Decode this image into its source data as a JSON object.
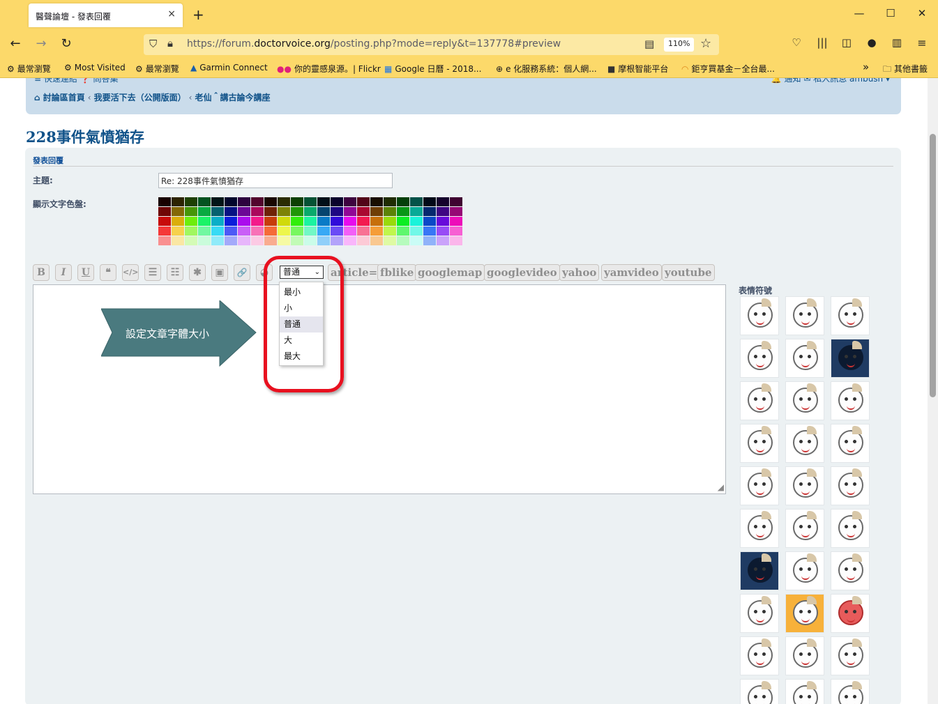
{
  "browser": {
    "tab_title": "醫聲論壇 - 發表回覆",
    "tab_close": "×",
    "new_tab": "+",
    "url_prefix": "https://forum.",
    "url_host": "doctorvoice.org",
    "url_path": "/posting.php?mode=reply&t=137778#preview",
    "zoom": "110%",
    "bookmarks": [
      {
        "label": "最常瀏覽",
        "icon": "⚙"
      },
      {
        "label": "Most Visited",
        "icon": "⚙"
      },
      {
        "label": "最常瀏覽",
        "icon": "⚙"
      },
      {
        "label": "Garmin Connect",
        "icon": "▲"
      },
      {
        "label": "你的靈感泉源。| Flickr",
        "icon": "●●"
      },
      {
        "label": "Google 日曆 - 2018...",
        "icon": "▦"
      },
      {
        "label": "e 化服務系統：個人網...",
        "icon": "⊕"
      },
      {
        "label": "摩根智能平台",
        "icon": "■"
      },
      {
        "label": "鉅亨買基金－全台最...",
        "icon": "◠"
      }
    ],
    "bookmarks_more": "»",
    "other_bookmarks": "其他書籤"
  },
  "forum": {
    "quick_links": "≡ 快速連結   ❓ 問答集",
    "user_links": "🔔 通知   ✉ 私人訊息   ambush ▾",
    "breadcrumb": [
      "討論區首頁",
      "我要活下去（公開版面）",
      "老仙＾講古論今講座"
    ],
    "topic_title": "228事件氣憤猶存",
    "panel_heading": "發表回覆",
    "subject_label": "主題:",
    "subject_value": "Re: 228事件氣憤猶存",
    "palette_label": "顯示文字色盤:",
    "toolbar": {
      "bold": "B",
      "italic": "I",
      "underline": "U",
      "quote": "❝",
      "code": "</>",
      "list": "☰",
      "list_numbered": "☷",
      "list_item": "✱",
      "image": "▣",
      "link": "🔗",
      "color": "◕",
      "font_size_selected": "普通",
      "custom_tags": [
        "article=",
        "fblike",
        "googlemap",
        "googlevideo",
        "yahoo",
        "yamvideo",
        "youtube"
      ]
    },
    "font_size_options": [
      "最小",
      "小",
      "普通",
      "大",
      "最大"
    ],
    "font_size_selected_index": 2,
    "callout_text": "設定文章字體大小",
    "smilies_heading": "表情符號",
    "smilies_count": 30
  },
  "colors": {
    "accent": "#105289",
    "highlight": "#e8101f",
    "arrow": "#4a7a7f",
    "chrome": "#fcd96a"
  }
}
